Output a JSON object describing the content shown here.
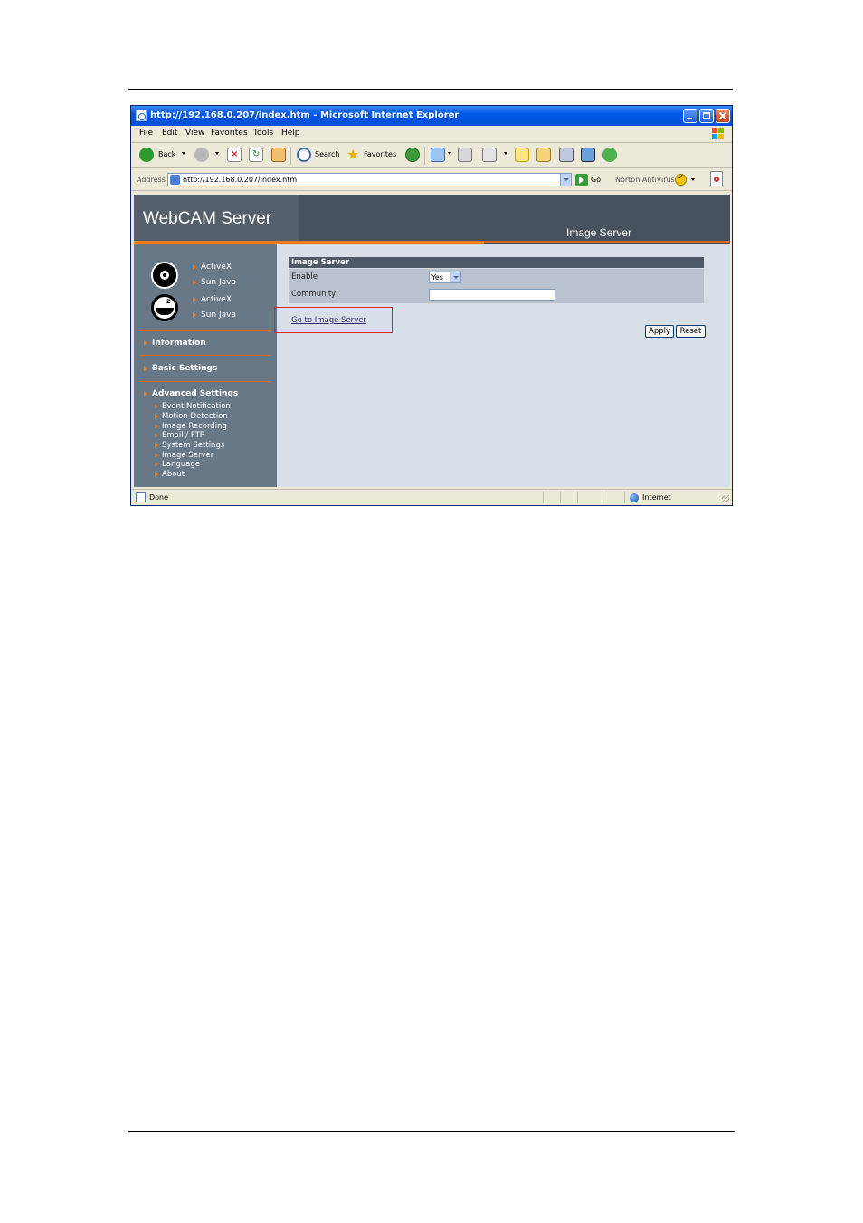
{
  "window": {
    "title": "http://192.168.0.207/index.htm - Microsoft Internet Explorer"
  },
  "menu": [
    "File",
    "Edit",
    "View",
    "Favorites",
    "Tools",
    "Help"
  ],
  "toolbar": {
    "back_label": "Back",
    "search_label": "Search",
    "favorites_label": "Favorites"
  },
  "address": {
    "label": "Address",
    "url": "http://192.168.0.207/index.htm",
    "go_label": "Go",
    "norton_label": "Norton AntiVirus"
  },
  "page": {
    "logo": "WebCAM Server",
    "title": "Image Server"
  },
  "sidebar": {
    "cam1": {
      "activex": "ActiveX",
      "java": "Sun Java"
    },
    "cam2": {
      "activex": "ActiveX",
      "java": "Sun Java"
    },
    "sections": {
      "information": "Information",
      "basic_settings": "Basic Settings",
      "advanced_settings": "Advanced Settings"
    },
    "advanced_items": [
      "Event Notification",
      "Motion Detection",
      "Image Recording",
      "Email / FTP",
      "System Settings",
      "Image Server",
      "Language",
      "About"
    ]
  },
  "form": {
    "header": "Image Server",
    "enable_label": "Enable",
    "enable_value": "Yes",
    "community_label": "Community",
    "community_value": "",
    "link": "Go to Image Server",
    "apply": "Apply",
    "reset": "Reset"
  },
  "status": {
    "text": "Done",
    "zone": "Internet"
  }
}
